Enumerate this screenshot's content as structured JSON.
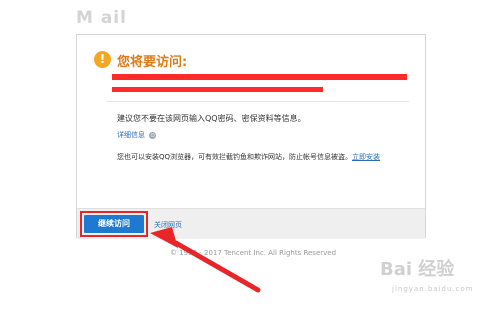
{
  "brand": {
    "logo_text": "M ail"
  },
  "warning": {
    "icon": "exclamation-icon",
    "icon_glyph": "!",
    "title": "您将要访问:",
    "redacted_url_color": "#ff2a2a"
  },
  "advice_text": "建议您不要在该网页输入QQ密码、密保资料等信息。",
  "details_link": {
    "label": "详细信息",
    "icon": "chevron-circle-icon",
    "icon_glyph": "⊙"
  },
  "browser_tip": {
    "text": "您也可以安装QQ浏览器，可有效拦截钓鱼和欺诈网站，防止帐号信息被盗。",
    "link": "立即安装"
  },
  "footer": {
    "continue_label": "继续访问",
    "close_label": "关闭网页",
    "accent": "#1e7ad1",
    "highlight": "#e8262a"
  },
  "copyright": "© 1998 - 2017 Tencent Inc. All Rights Reserved",
  "watermark": {
    "text": "Bai 经验",
    "sub": "jingyan.baidu.com"
  }
}
